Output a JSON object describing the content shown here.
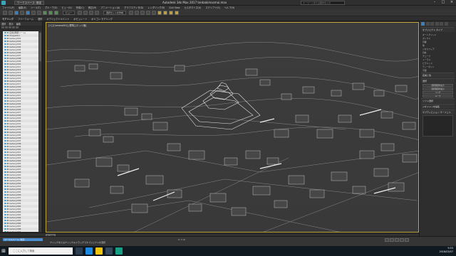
{
  "window": {
    "title": "Autodesk 3ds Max 2017   tenbakimasmai.max",
    "workspace": "ワークスペース: 既定",
    "search_placeholder": "キーワードまたは語句を入力"
  },
  "menu": [
    "ファイル(F)",
    "編集(E)",
    "ツール(T)",
    "グループ(G)",
    "ビュー(V)",
    "作成(C)",
    "修正(M)",
    "アニメーション(A)",
    "グラフエディタ(D)",
    "レンダリング(R)",
    "Civil View",
    "カスタマイズ(U)",
    "スクリプト(S)",
    "ヘルプ(H)"
  ],
  "toolbar": {
    "view_dropdown": "ビュー",
    "selset_dropdown": "選択セットを作成"
  },
  "ribbon": {
    "tabs": [
      "モデリング",
      "フリーフォーム",
      "選択",
      "オブジェクトペイント",
      "ポピュレート"
    ],
    "active": "モデリング",
    "sub": "ポリゴン モデリング"
  },
  "explorer": {
    "tabs": [
      "選択",
      "表示",
      "編集"
    ],
    "items": [
      "名前(昇順ソート)",
      "Shape001",
      "Gallery001",
      "Gallery002",
      "Gallery003",
      "Gallery004",
      "Gallery005",
      "Gallery006",
      "Gallery007",
      "Gallery008",
      "Gallery009",
      "Gallery010",
      "Gallery011",
      "Gallery012",
      "Gallery013",
      "Gallery014",
      "Gallery015",
      "Gallery016",
      "Gallery017",
      "Gallery018",
      "Gallery019",
      "Gallery020",
      "Gallery021",
      "Gallery022",
      "Gallery023",
      "Gallery024",
      "Gallery025",
      "Gallery026",
      "Gallery027",
      "Gallery028",
      "Gallery029",
      "Gallery030",
      "Gallery031",
      "Gallery032",
      "Gallery033",
      "Gallery034",
      "Gallery035",
      "Gallery036",
      "Gallery037",
      "Gallery038",
      "Gallery039",
      "Gallery040",
      "Gallery041",
      "Gallery042",
      "Gallery043",
      "Gallery044",
      "Gallery045",
      "Gallery046",
      "Gallery047",
      "Gallery048",
      "Gallery049",
      "Gallery050",
      "Gallery051",
      "Gallery052",
      "Gallery053",
      "Gallery054",
      "Gallery055",
      "Gallery056",
      "Gallery057",
      "Gallery058",
      "Gallery059",
      "Gallery060",
      "Gallery061",
      "Gallery062",
      "Gallery063",
      "Gallery064",
      "Gallery065",
      "Gallery066",
      "Gallery067",
      "Gallery068",
      "Gallery069"
    ]
  },
  "viewport": {
    "label": "[+] [Camera001] [標準] [エッジ面]"
  },
  "command_panel": {
    "sections": [
      "オブジェクト タイプ",
      "名前と色",
      "選択",
      "ソフト選択",
      "ジオメトリを編集",
      "サブディビジョン サーフェス"
    ],
    "rows": [
      "オートグリッド",
      "ボックス",
      "円錐",
      "球",
      "ジオスフィア",
      "円柱",
      "チューブ",
      "トーラス",
      "ピラミッド",
      "ティーポット",
      "平面"
    ],
    "buttons": [
      "選択範囲を拡大",
      "選択範囲を縮小",
      "リング",
      "ループ"
    ]
  },
  "timeline": {
    "position": "0 / 100"
  },
  "status": {
    "selection": "ワークスペース: 既定",
    "message": "クリックまたはクリック＆ドラッグでオブジェクトを選択",
    "coords": "X:  Y:  Z:"
  },
  "taskbar": {
    "search_placeholder": "ここに入力して検索",
    "time": "9:53",
    "date": "2018/03/07"
  }
}
